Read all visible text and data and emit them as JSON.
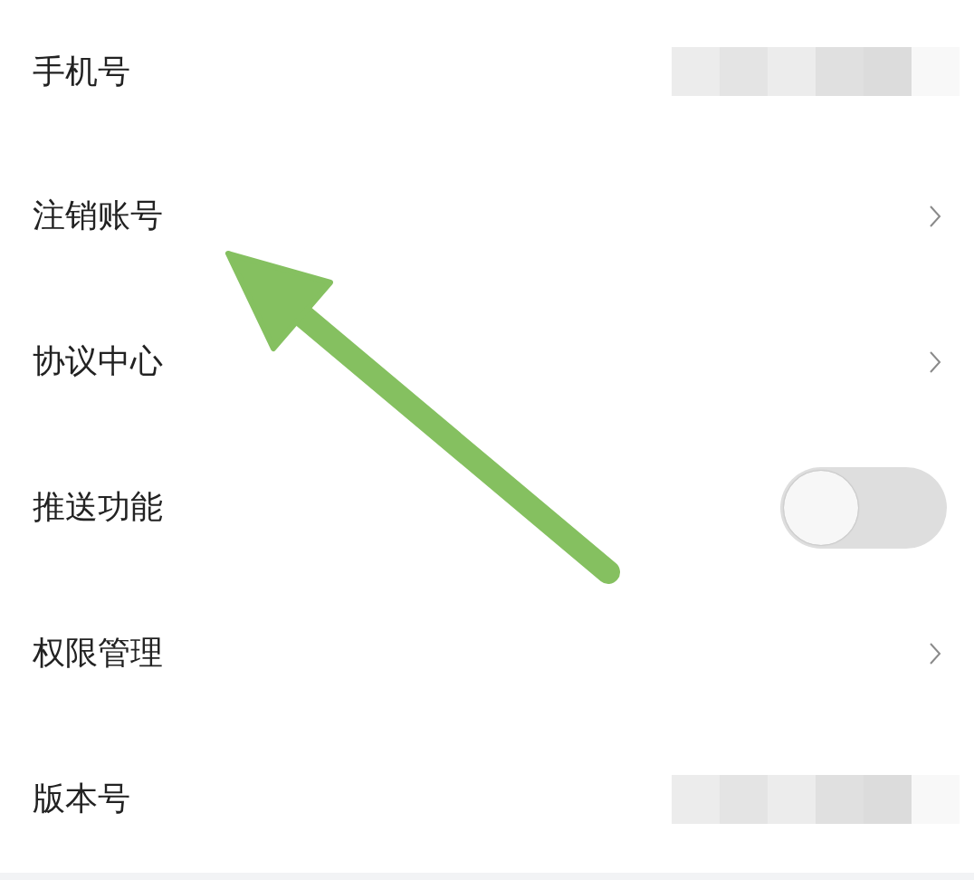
{
  "settings": [
    {
      "label": "手机号",
      "kind": "masked"
    },
    {
      "label": "注销账号",
      "kind": "link"
    },
    {
      "label": "协议中心",
      "kind": "link"
    },
    {
      "label": "推送功能",
      "kind": "toggle",
      "on": false
    },
    {
      "label": "权限管理",
      "kind": "link"
    },
    {
      "label": "版本号",
      "kind": "masked"
    }
  ]
}
